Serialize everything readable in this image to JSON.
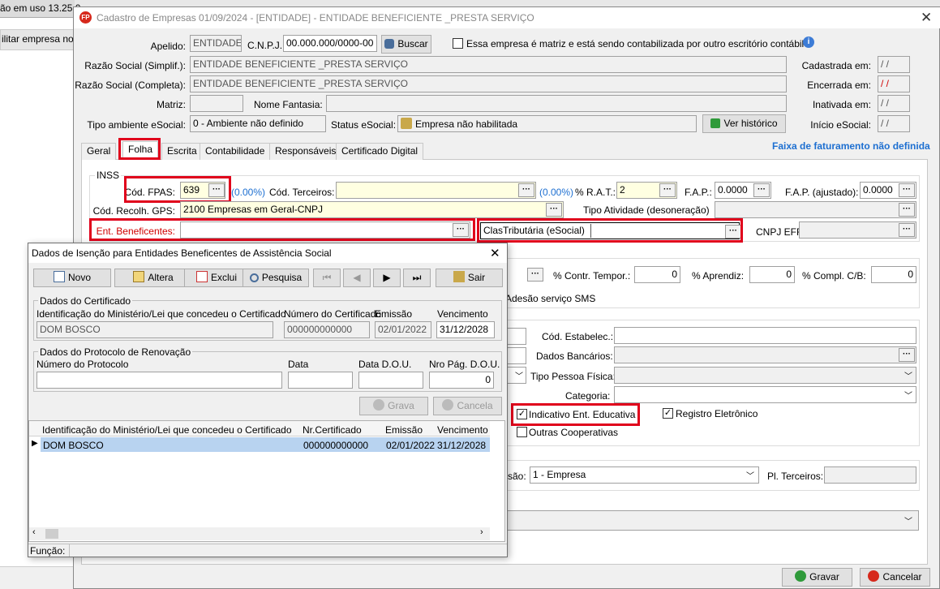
{
  "background": {
    "line1": "ão em uso 13.25.0",
    "line2": "ilitar empresa no"
  },
  "main": {
    "title": "Cadastro de Empresas  01/09/2024 - [ENTIDADE] - ENTIDADE BENEFICIENTE _PRESTA SERVIÇO",
    "apelido_label": "Apelido:",
    "apelido_value": "ENTIDADE",
    "cnpj_label": "C.N.P.J.:",
    "cnpj_value": "00.000.000/0000-00",
    "buscar": "Buscar",
    "matriz_check_label": "Essa empresa é matriz e está sendo contabilizada por outro escritório contábil",
    "razao_simpl_label": "Razão Social (Simplif.):",
    "razao_simpl_value": "ENTIDADE BENEFICIENTE _PRESTA SERVIÇO",
    "razao_comp_label": "Razão Social (Completa):",
    "razao_comp_value": "ENTIDADE BENEFICIENTE _PRESTA SERVIÇO",
    "matriz_label": "Matriz:",
    "fantasia_label": "Nome Fantasia:",
    "tipo_amb_label": "Tipo ambiente eSocial:",
    "tipo_amb_value": "0 - Ambiente não definido",
    "status_label": "Status eSocial:",
    "status_value": "Empresa não habilitada",
    "historico": "Ver histórico",
    "cadastrada_label": "Cadastrada em:",
    "cadastrada_value": "/ /",
    "encerrada_label": "Encerrada em:",
    "encerrada_value": "/ /",
    "inativada_label": "Inativada em:",
    "inativada_value": "/ /",
    "inicio_label": "Início eSocial:",
    "inicio_value": "/ /",
    "tabs": [
      "Geral",
      "Folha",
      "Escrita",
      "Contabilidade",
      "Responsáveis",
      "Certificado Digital"
    ],
    "faixa_link": "Faixa de faturamento não definida",
    "inss_label": "INSS",
    "fpas_label": "Cód. FPAS:",
    "fpas_value": "639",
    "fpas_pct": "(0.00%)",
    "terceiros_label": "Cód. Terceiros:",
    "terceiros_pct": "(0.00%)",
    "rat_label": "% R.A.T.:",
    "rat_value": "2",
    "fap_label": "F.A.P.:",
    "fap_value": "0.0000",
    "fapaj_label": "F.A.P. (ajustado):",
    "fapaj_value": "0.0000",
    "gps_label": "Cód. Recolh. GPS:",
    "gps_value": "2100 Empresas em Geral-CNPJ",
    "tipo_ativ_label": "Tipo Atividade (desoneração)",
    "ent_benef_label": "Ent. Beneficentes:",
    "clas_trib_label": "ClasTributária (eSocial)",
    "cnpj_efr_label": "CNPJ EFR",
    "contr_temp_label": "% Contr. Tempor.:",
    "contr_temp_value": "0",
    "aprendiz_label": "% Aprendiz:",
    "aprendiz_value": "0",
    "compl_label": "% Compl. C/B:",
    "compl_value": "0",
    "sms_label": "Adesão serviço SMS",
    "estab_label": "Cód. Estabelec.:",
    "bancarios_label": "Dados Bancários:",
    "tipo_pf_label": "Tipo Pessoa Física:",
    "categoria_label": "Categoria:",
    "ind_educ_label": "Indicativo Ent. Educativa",
    "reg_elet_label": "Registro Eletrônico",
    "outras_coop_label": "Outras Cooperativas",
    "sao_label": "são:",
    "empresa_value": "1 - Empresa",
    "pl_terceiros_label": "Pl. Terceiros:",
    "gravar": "Gravar",
    "cancelar": "Cancelar"
  },
  "dialog": {
    "title": "Dados de Isenção para Entidades Beneficentes de Assistência Social",
    "novo": "Novo",
    "altera": "Altera",
    "exclui": "Exclui",
    "pesquisa": "Pesquisa",
    "sair": "Sair",
    "nav": [
      "⏮",
      "◀",
      "▶",
      "⏭"
    ],
    "cert_group": "Dados do Certificado",
    "ident_label": "Identificação do Ministério/Lei que concedeu o Certificado",
    "ident_value": "DOM BOSCO",
    "num_cert_label": "Número do Certificado",
    "num_cert_value": "000000000000",
    "emissao_label": "Emissão",
    "emissao_value": "02/01/2022",
    "venc_label": "Vencimento",
    "venc_value": "31/12/2028",
    "prot_group": "Dados do Protocolo de Renovação",
    "num_prot_label": "Número do Protocolo",
    "data_label": "Data",
    "dou_label": "Data D.O.U.",
    "pag_label": "Nro Pág. D.O.U.",
    "pag_value": "0",
    "grava": "Grava",
    "cancela": "Cancela",
    "grid_headers": [
      "Identificação do Ministério/Lei que concedeu o Certificado",
      "Nr.Certificado",
      "Emissão",
      "Vencimento"
    ],
    "grid_row": [
      "DOM BOSCO",
      "000000000000",
      "02/01/2022",
      "31/12/2028"
    ],
    "funcao_label": "Função:"
  }
}
